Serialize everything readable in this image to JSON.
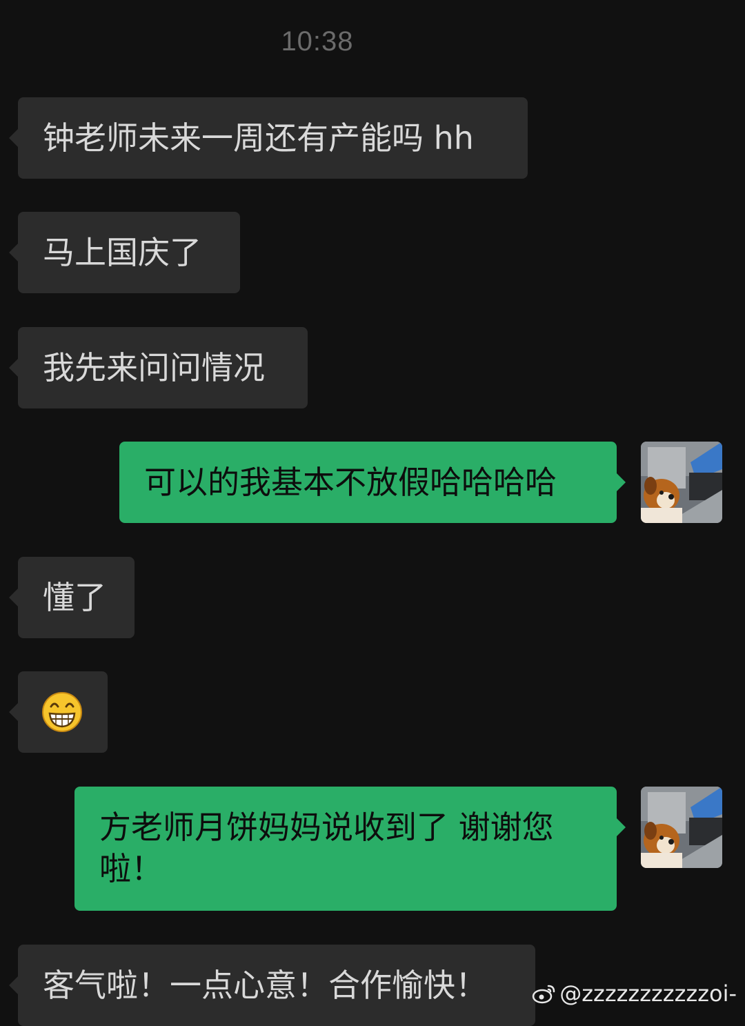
{
  "status": {
    "time": "10:38"
  },
  "messages": [
    {
      "side": "in",
      "text": "钟老师未来一周还有产能吗 hh"
    },
    {
      "side": "in",
      "text": "马上国庆了"
    },
    {
      "side": "in",
      "text": "我先来问问情况"
    },
    {
      "side": "out",
      "text": "可以的我基本不放假哈哈哈哈"
    },
    {
      "side": "in",
      "text": "懂了"
    },
    {
      "side": "in",
      "emoji": "grin-emoji"
    },
    {
      "side": "out",
      "text": "方老师月饼妈妈说收到了 谢谢您啦！"
    },
    {
      "side": "in",
      "text": "客气啦！一点心意！合作愉快！"
    }
  ],
  "watermark": {
    "text": "@zzzzzzzzzzzoi-",
    "icon": "weibo-icon"
  },
  "colors": {
    "background": "#111111",
    "incoming_bubble": "#2c2c2c",
    "outgoing_bubble": "#2aae67"
  }
}
